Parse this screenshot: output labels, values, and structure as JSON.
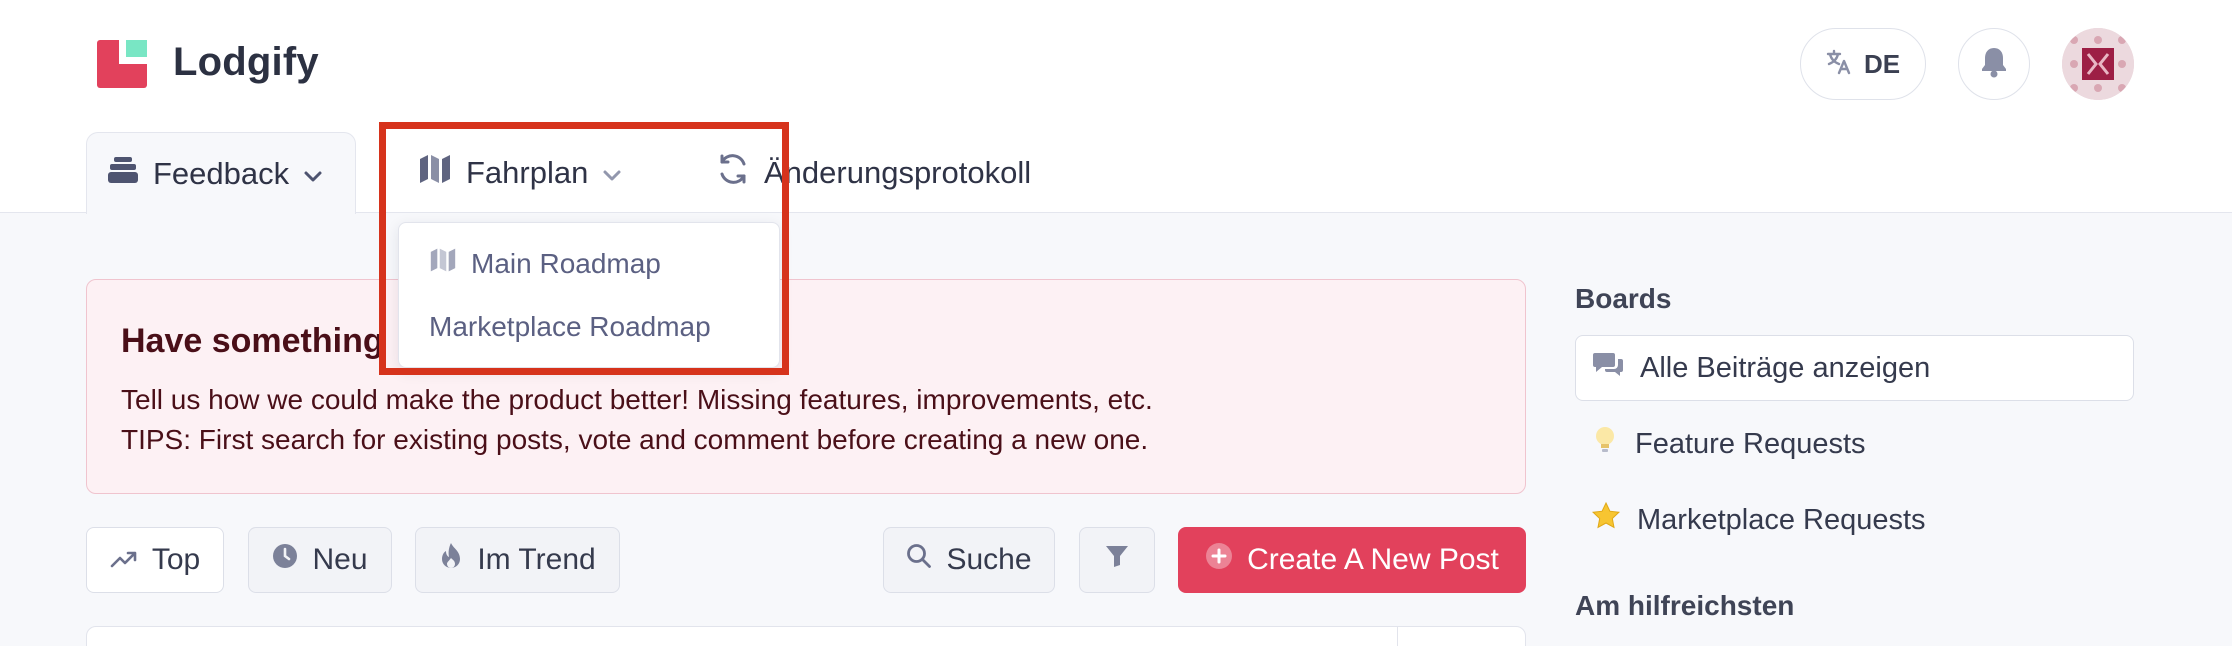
{
  "brand": {
    "name": "Lodgify",
    "accent_color": "#e2415c",
    "mint_color": "#79e6c4"
  },
  "header": {
    "language_label": "DE",
    "language_icon": "translate-icon",
    "notification_icon": "bell-icon",
    "avatar_icon": "user-avatar"
  },
  "tabs": [
    {
      "label": "Feedback",
      "icon": "stack-icon",
      "has_dropdown": true
    },
    {
      "label": "Fahrplan",
      "icon": "map-icon",
      "has_dropdown": true
    },
    {
      "label": "Änderungsprotokoll",
      "icon": "refresh-icon",
      "has_dropdown": false
    }
  ],
  "roadmap_dropdown": {
    "items": [
      {
        "label": "Main Roadmap",
        "icon": "map-icon"
      },
      {
        "label": "Marketplace Roadmap"
      }
    ]
  },
  "banner": {
    "title": "Have something",
    "line1": "Tell us how we could make the product better! Missing features, improvements, etc.",
    "line2": "TIPS: First search for existing posts, vote and comment before creating a new one."
  },
  "filters": {
    "top": "Top",
    "new": "Neu",
    "trending": "Im Trend",
    "search": "Suche",
    "create": "Create A New Post"
  },
  "sidebar": {
    "boards_heading": "Boards",
    "items": [
      {
        "label": "Alle Beiträge anzeigen",
        "icon": "chat-bubbles-icon",
        "active": true
      },
      {
        "label": "Feature Requests",
        "icon": "lightbulb-icon"
      },
      {
        "label": "Marketplace Requests",
        "icon": "star-icon"
      }
    ],
    "helpful_heading": "Am hilfreichsten"
  }
}
